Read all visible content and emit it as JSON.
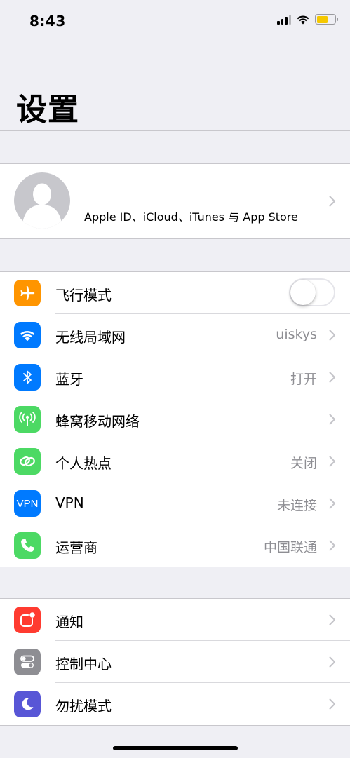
{
  "status_bar": {
    "time": "8:43",
    "signal_bars_active": 3,
    "signal_bars_total": 4,
    "battery_level": 0.62,
    "battery_color": "#f5c800"
  },
  "header": {
    "title": "设置"
  },
  "profile": {
    "label": "Apple ID、iCloud、iTunes 与 App Store",
    "avatar_icon": "person-silhouette-icon"
  },
  "network_group": [
    {
      "label": "飞行模式",
      "icon": "airplane-icon",
      "color": "#ff9500",
      "toggle": false
    },
    {
      "label": "无线局域网",
      "icon": "wifi-icon",
      "color": "#007aff",
      "value": "uiskys"
    },
    {
      "label": "蓝牙",
      "icon": "bluetooth-icon",
      "color": "#007aff",
      "value": "打开"
    },
    {
      "label": "蜂窝移动网络",
      "icon": "cellular-icon",
      "color": "#4cd964"
    },
    {
      "label": "个人热点",
      "icon": "hotspot-icon",
      "color": "#4cd964",
      "value": "关闭"
    },
    {
      "label": "VPN",
      "icon": "vpn-icon",
      "icon_text": "VPN",
      "color": "#007aff",
      "value": "未连接"
    },
    {
      "label": "运营商",
      "icon": "phone-icon",
      "color": "#4cd964",
      "value": "中国联通"
    }
  ],
  "system_group": [
    {
      "label": "通知",
      "icon": "notifications-icon",
      "color": "#ff3b30"
    },
    {
      "label": "控制中心",
      "icon": "control-center-icon",
      "color": "#8e8e93"
    },
    {
      "label": "勿扰模式",
      "icon": "moon-icon",
      "color": "#5856d6"
    }
  ]
}
